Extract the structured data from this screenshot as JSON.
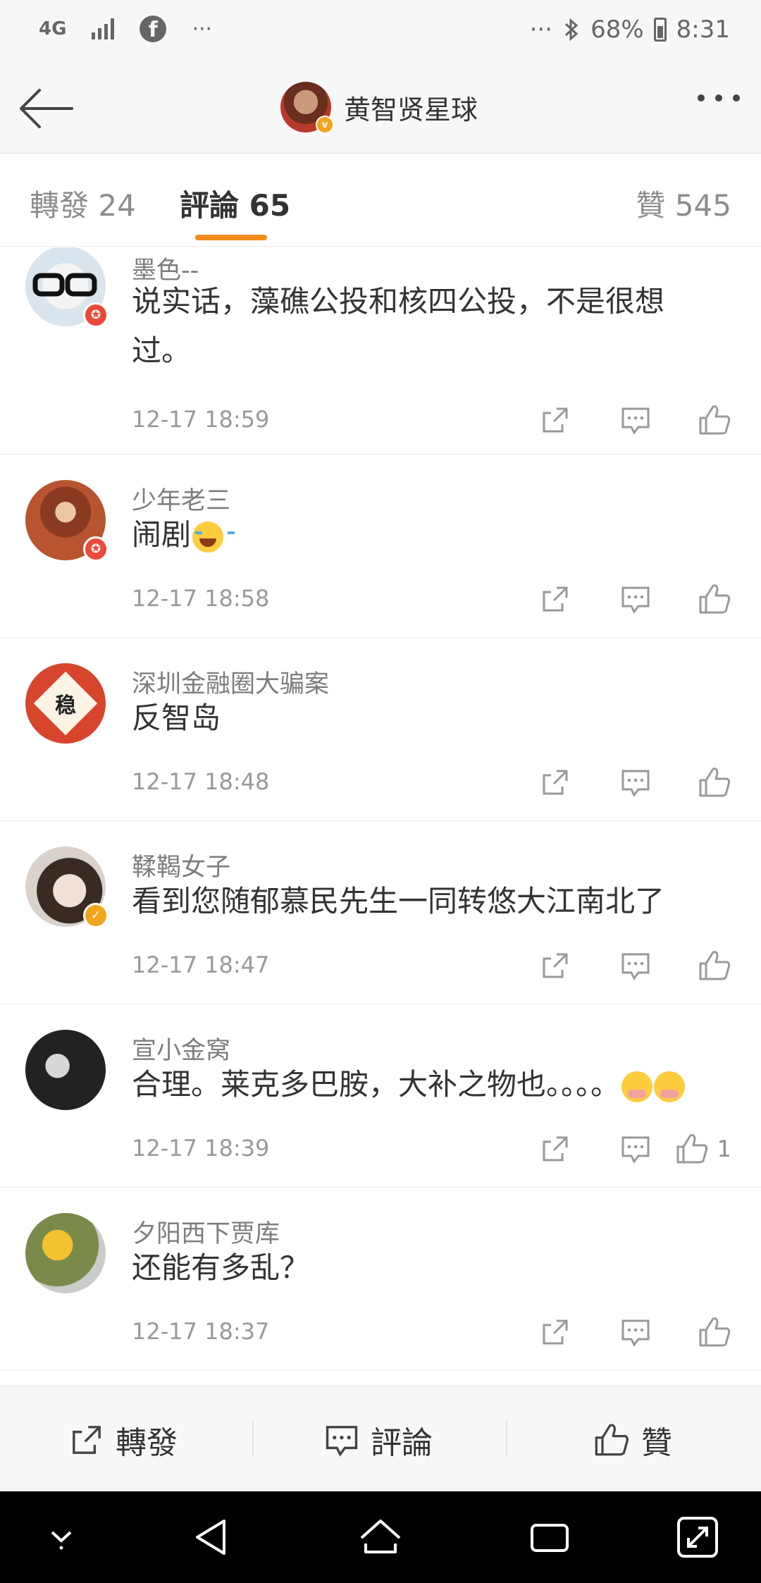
{
  "status_bar": {
    "network": "4G",
    "ellipsis_left": "···",
    "ellipsis_right": "···",
    "battery": "68%",
    "time": "8:31"
  },
  "header": {
    "title": "黄智贤星球",
    "avatar_badge": "v"
  },
  "tabs": [
    {
      "label": "轉發 24"
    },
    {
      "label": "評論 65"
    },
    {
      "label": "贊 545"
    }
  ],
  "comments": [
    {
      "name": "墨色--",
      "text": "说实话，藻礁公投和核四公投，不是很想过。",
      "time": "12-17 18:59",
      "badge": "red",
      "likes": ""
    },
    {
      "name": "少年老三",
      "text": "闹剧",
      "emoji": "laugh",
      "time": "12-17 18:58",
      "badge": "red",
      "likes": ""
    },
    {
      "name": "深圳金融圈大骗案",
      "text": "反智岛",
      "time": "12-17 18:48",
      "badge": "",
      "avatar_glyph": "稳",
      "likes": ""
    },
    {
      "name": "鞣鞨女子",
      "text": "看到您随郁慕民先生一同转悠大江南北了",
      "time": "12-17 18:47",
      "badge": "gold",
      "likes": ""
    },
    {
      "name": "宣小金窝",
      "text": "合理。莱克多巴胺，大补之物也。。。。",
      "emoji": "shy",
      "time": "12-17 18:39",
      "badge": "",
      "likes": "1"
    },
    {
      "name": "夕阳西下贾库",
      "text": "还能有多乱？",
      "time": "12-17 18:37",
      "badge": "",
      "likes": ""
    }
  ],
  "bottom_bar": {
    "repost_label": "轉發",
    "comment_label": "評論",
    "like_label": "贊"
  },
  "colors": {
    "accent": "#f28b1a",
    "badge_red": "#ea4a38",
    "badge_gold": "#f1a51d"
  },
  "icons": [
    "back-arrow-icon",
    "more-icon",
    "repost-icon",
    "comment-icon",
    "like-icon",
    "bluetooth-icon",
    "facebook-icon"
  ]
}
